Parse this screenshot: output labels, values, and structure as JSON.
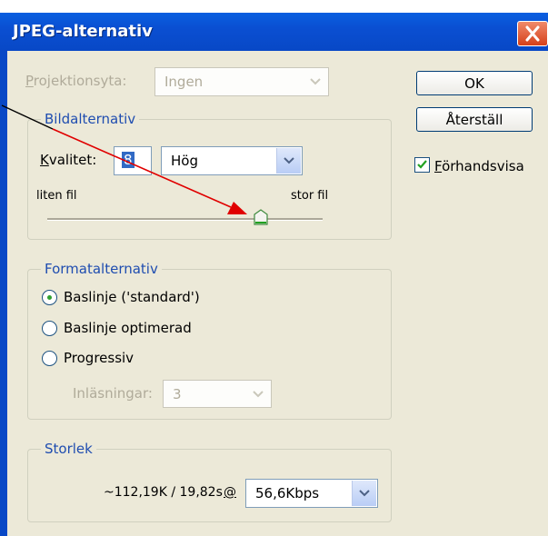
{
  "window": {
    "title": "JPEG-alternativ"
  },
  "matte": {
    "label_first": "P",
    "label_rest": "rojektionsyta:",
    "value": "Ingen"
  },
  "image_options": {
    "legend": "Bildalternativ",
    "quality_label_first": "K",
    "quality_label_rest": "valitet:",
    "quality_value": "8",
    "quality_preset": "Hög",
    "small_label": "liten fil",
    "large_label": "stor fil"
  },
  "format_options": {
    "legend": "Formatalternativ",
    "options": [
      {
        "label": "Baslinje ('standard')",
        "selected": true
      },
      {
        "label": "Baslinje optimerad",
        "selected": false
      },
      {
        "label": "Progressiv",
        "selected": false
      }
    ],
    "scans_label": "Inläsningar:",
    "scans_value": "3"
  },
  "size": {
    "legend": "Storlek",
    "estimate": "~112,19K / 19,82s",
    "at_symbol": "@",
    "speed": "56,6Kbps"
  },
  "buttons": {
    "ok": "OK",
    "reset": "Återställ"
  },
  "preview": {
    "label_first": "F",
    "label_rest": "örhandsvisa",
    "checked": true
  },
  "colors": {
    "titlebar": "#0a4fd2",
    "dialog_bg": "#ece9d8",
    "group_legend": "#1f4db0",
    "arrow": "#e00000"
  }
}
